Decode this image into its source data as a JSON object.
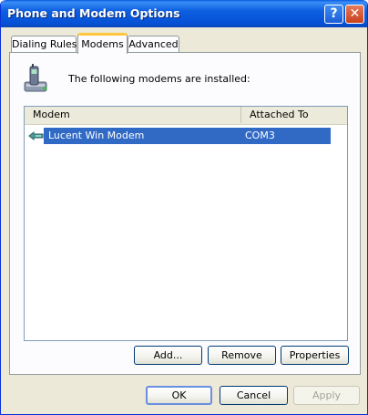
{
  "window": {
    "title": "Phone and Modem Options",
    "help_glyph": "?",
    "close_glyph": "✕"
  },
  "tabs": [
    {
      "label": "Dialing Rules",
      "selected": false
    },
    {
      "label": "Modems",
      "selected": true
    },
    {
      "label": "Advanced",
      "selected": false
    }
  ],
  "modems_tab": {
    "intro_text": "The following modems are  installed:",
    "icon": "phone-modem-icon",
    "columns": [
      "Modem",
      "Attached To"
    ],
    "rows": [
      {
        "modem": "Lucent Win Modem",
        "attached_to": "COM3",
        "selected": true,
        "icon": "modem-icon"
      }
    ],
    "buttons": {
      "add": "Add...",
      "remove": "Remove",
      "properties": "Properties"
    }
  },
  "dialog_buttons": {
    "ok": "OK",
    "cancel": "Cancel",
    "apply": "Apply",
    "apply_enabled": false
  },
  "colors": {
    "titlebar": "#0551d6",
    "selection": "#316ac5",
    "selected_tab_accent": "#ffc83c",
    "dialog_bg": "#ece9d8"
  }
}
